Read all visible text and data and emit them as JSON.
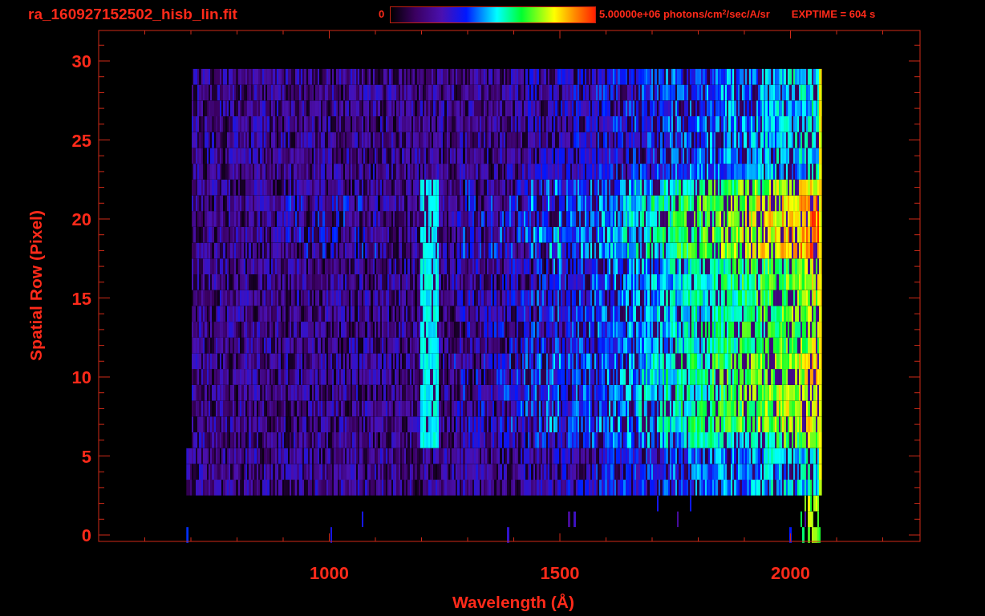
{
  "plot": {
    "title": "ra_160927152502_hisb_lin.fit",
    "colorbar": {
      "min_label": "0",
      "max_label": "5.00000e+06 photons/cm$^{2}$/sec/A/sr"
    },
    "exposure": "EXPTIME = 604 s",
    "x_axis": {
      "label": "Wavelength (Å)",
      "tick_labels": [
        "1000",
        "1500",
        "2000"
      ]
    },
    "y_axis": {
      "label": "Spatial Row (Pixel)",
      "tick_labels": [
        "30",
        "25",
        "20",
        "15",
        "10",
        "5",
        "0"
      ]
    }
  }
}
